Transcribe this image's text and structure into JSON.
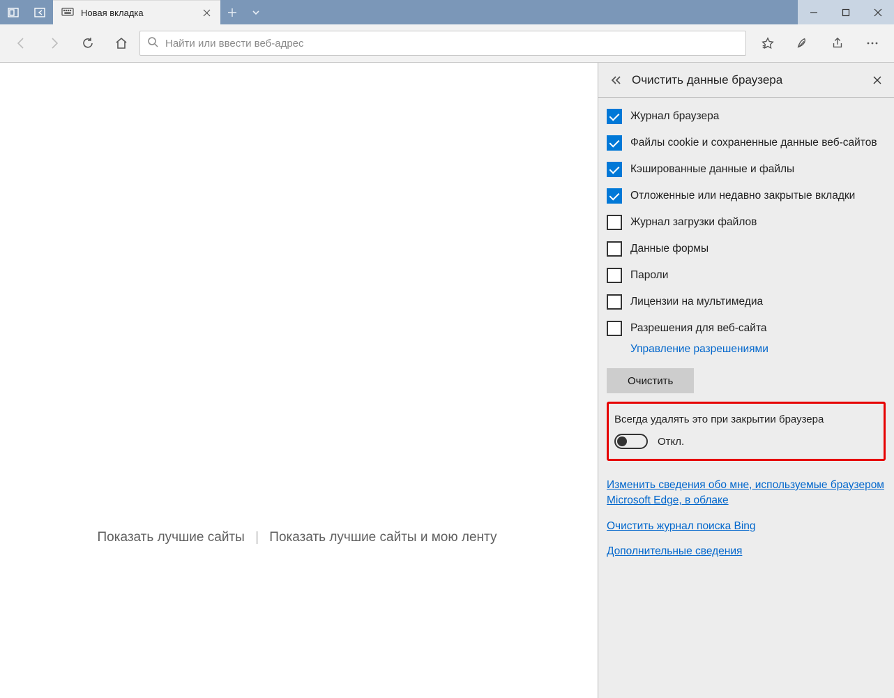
{
  "tab": {
    "label": "Новая вкладка"
  },
  "addressbar": {
    "placeholder": "Найти или ввести веб-адрес"
  },
  "newtab": {
    "topSites": "Показать лучшие сайты",
    "topSitesFeed": "Показать лучшие сайты и мою ленту"
  },
  "panel": {
    "title": "Очистить данные браузера",
    "checks": [
      {
        "label": "Журнал браузера",
        "checked": true
      },
      {
        "label": "Файлы cookie и сохраненные данные веб-сайтов",
        "checked": true
      },
      {
        "label": "Кэшированные данные и файлы",
        "checked": true
      },
      {
        "label": "Отложенные или недавно закрытые вкладки",
        "checked": true
      },
      {
        "label": "Журнал загрузки файлов",
        "checked": false
      },
      {
        "label": "Данные формы",
        "checked": false
      },
      {
        "label": "Пароли",
        "checked": false
      },
      {
        "label": "Лицензии на мультимедиа",
        "checked": false
      },
      {
        "label": "Разрешения для веб-сайта",
        "checked": false
      }
    ],
    "managePermissions": "Управление разрешениями",
    "clearButton": "Очистить",
    "alwaysClear": {
      "label": "Всегда удалять это при закрытии браузера",
      "state": "Откл."
    },
    "links": {
      "changeInfo": "Изменить сведения обо мне, используемые браузером Microsoft Edge, в облаке",
      "clearBing": "Очистить журнал поиска Bing",
      "moreInfo": "Дополнительные сведения"
    }
  }
}
